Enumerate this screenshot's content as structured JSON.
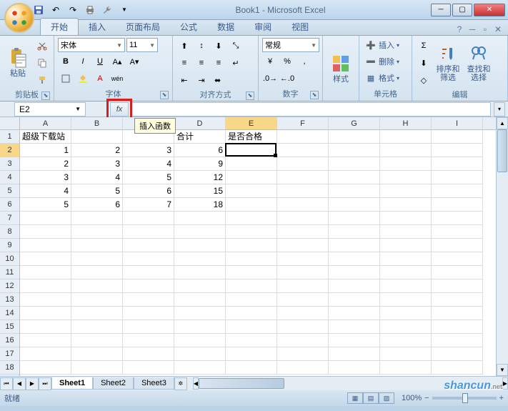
{
  "window": {
    "title": "Book1 - Microsoft Excel"
  },
  "qat": {
    "save": "💾",
    "undo": "↶",
    "redo": "↷",
    "print": "🖨",
    "more": "▾"
  },
  "tabs": {
    "items": [
      "开始",
      "插入",
      "页面布局",
      "公式",
      "数据",
      "审阅",
      "视图"
    ],
    "active": 0
  },
  "ribbon": {
    "clipboard": {
      "label": "剪贴板",
      "paste": "粘贴"
    },
    "font": {
      "label": "字体",
      "name": "宋体",
      "size": "11"
    },
    "alignment": {
      "label": "对齐方式"
    },
    "number": {
      "label": "数字",
      "format": "常规"
    },
    "styles": {
      "label": "样式",
      "btn": "样式"
    },
    "cells": {
      "label": "单元格",
      "insert": "插入",
      "delete": "删除",
      "format": "格式"
    },
    "editing": {
      "label": "编辑",
      "sort": "排序和\n筛选",
      "find": "查找和\n选择"
    }
  },
  "formula_bar": {
    "name_box": "E2",
    "fx_tooltip": "插入函数",
    "value": ""
  },
  "grid": {
    "columns": [
      "A",
      "B",
      "C",
      "D",
      "E",
      "F",
      "G",
      "H",
      "I"
    ],
    "rows": 18,
    "selected_cell": {
      "row": 2,
      "col": 5
    },
    "data": [
      [
        "超级下载站",
        "",
        "",
        "合计",
        "是否合格",
        "",
        "",
        "",
        ""
      ],
      [
        "1",
        "2",
        "3",
        "6",
        "",
        "",
        "",
        "",
        ""
      ],
      [
        "2",
        "3",
        "4",
        "9",
        "",
        "",
        "",
        "",
        ""
      ],
      [
        "3",
        "4",
        "5",
        "12",
        "",
        "",
        "",
        "",
        ""
      ],
      [
        "4",
        "5",
        "6",
        "15",
        "",
        "",
        "",
        "",
        ""
      ],
      [
        "5",
        "6",
        "7",
        "18",
        "",
        "",
        "",
        "",
        ""
      ]
    ]
  },
  "sheets": {
    "items": [
      "Sheet1",
      "Sheet2",
      "Sheet3"
    ],
    "active": 0
  },
  "status": {
    "text": "就绪",
    "zoom": "100%"
  },
  "watermark": {
    "main": "shancun",
    "sub": ".net"
  }
}
